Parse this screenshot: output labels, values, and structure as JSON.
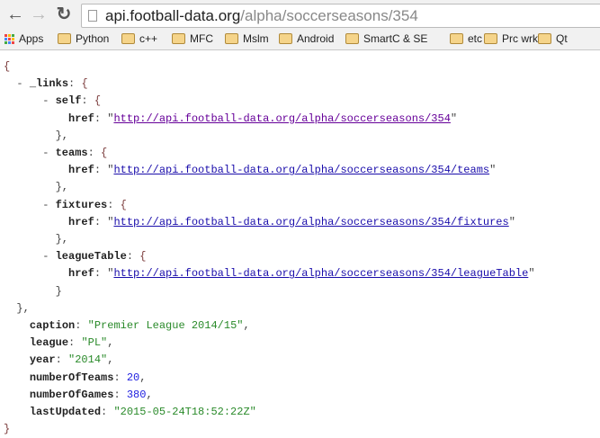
{
  "browser": {
    "url_host": "api.football-data.org",
    "url_path": "/alpha/soccerseasons/354",
    "bookmarks": [
      "Apps",
      "Python",
      "c++",
      "MFC",
      "Mslm",
      "Android",
      "SmartC & SE",
      "etc",
      "Prc wrk",
      "Qt"
    ]
  },
  "json": {
    "links_key": "_links",
    "links": [
      {
        "key": "self",
        "href": "http://api.football-data.org/alpha/soccerseasons/354"
      },
      {
        "key": "teams",
        "href": "http://api.football-data.org/alpha/soccerseasons/354/teams"
      },
      {
        "key": "fixtures",
        "href": "http://api.football-data.org/alpha/soccerseasons/354/fixtures"
      },
      {
        "key": "leagueTable",
        "href": "http://api.football-data.org/alpha/soccerseasons/354/leagueTable"
      }
    ],
    "fields": [
      {
        "key": "caption",
        "value": "\"Premier League 2014/15\"",
        "type": "s"
      },
      {
        "key": "league",
        "value": "\"PL\"",
        "type": "s"
      },
      {
        "key": "year",
        "value": "\"2014\"",
        "type": "s"
      },
      {
        "key": "numberOfTeams",
        "value": "20",
        "type": "n"
      },
      {
        "key": "numberOfGames",
        "value": "380",
        "type": "n"
      },
      {
        "key": "lastUpdated",
        "value": "\"2015-05-24T18:52:22Z\"",
        "type": "s"
      }
    ]
  }
}
